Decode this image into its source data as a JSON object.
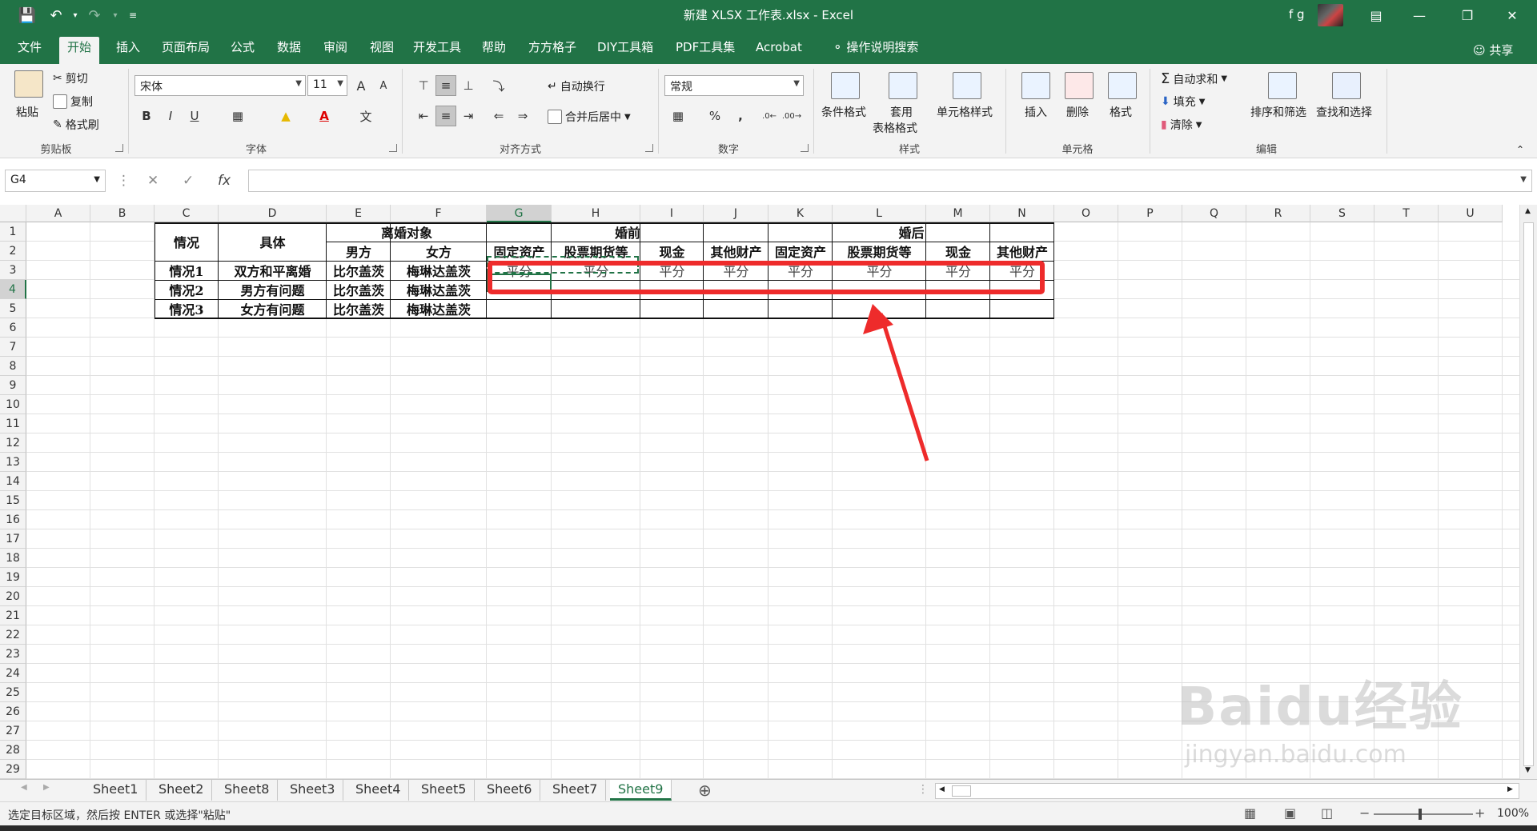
{
  "window": {
    "title": "新建 XLSX 工作表.xlsx  -  Excel",
    "user": "f g"
  },
  "ribbon_tabs": [
    "文件",
    "开始",
    "插入",
    "页面布局",
    "公式",
    "数据",
    "审阅",
    "视图",
    "开发工具",
    "帮助",
    "方方格子",
    "DIY工具箱",
    "PDF工具集",
    "Acrobat",
    "操作说明搜索"
  ],
  "share_label": "共享",
  "clipboard": {
    "paste": "粘贴",
    "cut": "剪切",
    "copy": "复制",
    "painter": "格式刷",
    "group": "剪贴板"
  },
  "font": {
    "name": "宋体",
    "size": "11",
    "bold": "B",
    "italic": "I",
    "underline": "U",
    "group": "字体",
    "grow": "A",
    "shrink": "A",
    "color_glyph": "A",
    "phonetic": "文"
  },
  "alignment": {
    "wrap": "自动换行",
    "merge": "合并后居中",
    "group": "对齐方式"
  },
  "number": {
    "format": "常规",
    "percent": "%",
    "comma": ",",
    "group": "数字"
  },
  "styles": {
    "conditional": "条件格式",
    "table1": "套用",
    "table2": "表格格式",
    "cell_styles": "单元格样式",
    "group": "样式"
  },
  "cells": {
    "insert": "插入",
    "delete": "删除",
    "format": "格式",
    "group": "单元格"
  },
  "editing": {
    "autosum": "自动求和",
    "fill": "填充",
    "clear": "清除",
    "sort": "排序和筛选",
    "find": "查找和选择",
    "group": "编辑"
  },
  "formula_bar": {
    "name_box": "G4",
    "fx": "fx",
    "value": ""
  },
  "columns": [
    "A",
    "B",
    "C",
    "D",
    "E",
    "F",
    "G",
    "H",
    "I",
    "J",
    "K",
    "L",
    "M",
    "N",
    "O",
    "P",
    "Q",
    "R",
    "S",
    "T",
    "U"
  ],
  "selected_column": "G",
  "selected_row": "4",
  "rows": [
    "1",
    "2",
    "3",
    "4",
    "5",
    "6",
    "7",
    "8",
    "9",
    "10",
    "11",
    "12",
    "13",
    "14",
    "15",
    "16",
    "17",
    "18",
    "19",
    "20",
    "21",
    "22",
    "23",
    "24",
    "25",
    "26",
    "27",
    "28",
    "29"
  ],
  "table": {
    "header_situation": "情况",
    "header_detail": "具体",
    "header_target": "离婚对象",
    "header_male": "男方",
    "header_female": "女方",
    "header_before": "婚前",
    "header_after": "婚后",
    "asset_headers": [
      "固定资产",
      "股票期货等",
      "现金",
      "其他财产",
      "固定资产",
      "股票期货等",
      "现金",
      "其他财产"
    ],
    "rows": [
      {
        "situation": "情况1",
        "detail": "双方和平离婚",
        "male": "比尔盖茨",
        "female": "梅琳达盖茨",
        "values": [
          "平分",
          "平分",
          "平分",
          "平分",
          "平分",
          "平分",
          "平分",
          "平分"
        ]
      },
      {
        "situation": "情况2",
        "detail": "男方有问题",
        "male": "比尔盖茨",
        "female": "梅琳达盖茨",
        "values": [
          "",
          "",
          "",
          "",
          "",
          "",
          "",
          ""
        ]
      },
      {
        "situation": "情况3",
        "detail": "女方有问题",
        "male": "比尔盖茨",
        "female": "梅琳达盖茨",
        "values": [
          "",
          "",
          "",
          "",
          "",
          "",
          "",
          ""
        ]
      }
    ]
  },
  "sheets": [
    "Sheet1",
    "Sheet2",
    "Sheet8",
    "Sheet3",
    "Sheet4",
    "Sheet5",
    "Sheet6",
    "Sheet7",
    "Sheet9"
  ],
  "active_sheet": "Sheet9",
  "status": {
    "message": "选定目标区域，然后按 ENTER 或选择\"粘贴\"",
    "zoom": "100%"
  },
  "watermark": {
    "brand": "Baidu经验",
    "url": "jingyan.baidu.com"
  },
  "colors": {
    "excel_green": "#217346",
    "annotation_red": "#ee2b2b"
  }
}
